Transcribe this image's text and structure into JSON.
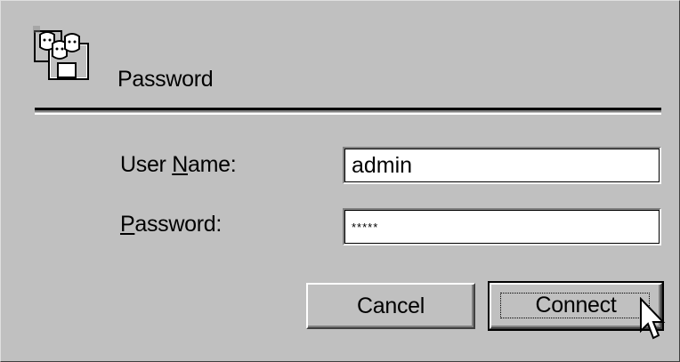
{
  "dialog": {
    "title": "Password",
    "icon": "users-icon"
  },
  "form": {
    "user_name": {
      "label_prefix": "User ",
      "label_accel": "N",
      "label_suffix": "ame:",
      "value": "admin"
    },
    "password": {
      "label_accel": "P",
      "label_suffix": "assword:",
      "value": "*****"
    }
  },
  "buttons": {
    "cancel_label": "Cancel",
    "connect_label": "Connect"
  },
  "colors": {
    "face": "#c0c0c0",
    "highlight": "#ffffff",
    "shadow": "#808080",
    "dark_shadow": "#404040"
  }
}
